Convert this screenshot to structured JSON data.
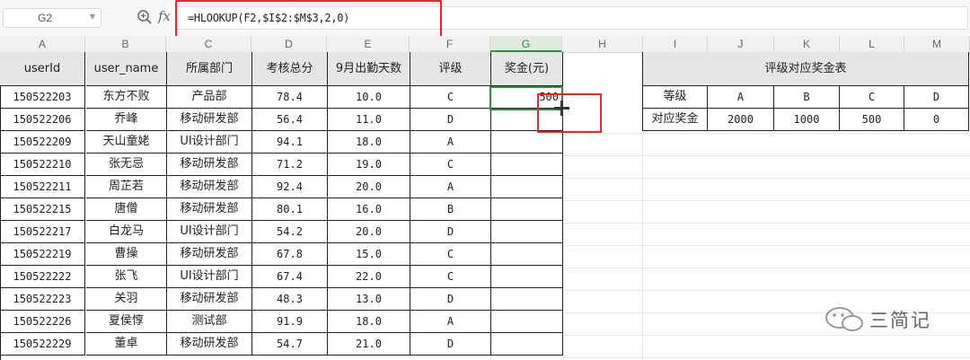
{
  "formula_bar": {
    "name_box": "G2",
    "formula": "=HLOOKUP(F2,$I$2:$M$3,2,0)"
  },
  "columns": [
    "A",
    "B",
    "C",
    "D",
    "E",
    "F",
    "G",
    "H",
    "I",
    "J",
    "K",
    "L",
    "M"
  ],
  "selected_column": "G",
  "main_table": {
    "headers": [
      "userId",
      "user_name",
      "所属部门",
      "考核总分",
      "9月出勤天数",
      "评级",
      "奖金(元)"
    ],
    "rows": [
      [
        "150522203",
        "东方不败",
        "产品部",
        "78.4",
        "10.0",
        "C",
        "500"
      ],
      [
        "150522206",
        "乔峰",
        "移动研发部",
        "56.4",
        "11.0",
        "D",
        ""
      ],
      [
        "150522209",
        "天山童姥",
        "UI设计部门",
        "94.1",
        "18.0",
        "A",
        ""
      ],
      [
        "150522210",
        "张无忌",
        "移动研发部",
        "71.2",
        "19.0",
        "C",
        ""
      ],
      [
        "150522211",
        "周芷若",
        "移动研发部",
        "92.4",
        "20.0",
        "A",
        ""
      ],
      [
        "150522215",
        "唐僧",
        "移动研发部",
        "80.1",
        "16.0",
        "B",
        ""
      ],
      [
        "150522217",
        "白龙马",
        "UI设计部门",
        "54.2",
        "20.0",
        "D",
        ""
      ],
      [
        "150522219",
        "曹操",
        "移动研发部",
        "67.8",
        "15.0",
        "C",
        ""
      ],
      [
        "150522222",
        "张飞",
        "UI设计部门",
        "67.4",
        "22.0",
        "C",
        ""
      ],
      [
        "150522223",
        "关羽",
        "移动研发部",
        "48.3",
        "13.0",
        "D",
        ""
      ],
      [
        "150522226",
        "夏侯惇",
        "测试部",
        "91.9",
        "18.0",
        "A",
        ""
      ],
      [
        "150522229",
        "董卓",
        "移动研发部",
        "54.7",
        "21.0",
        "D",
        ""
      ]
    ]
  },
  "lookup_table": {
    "title": "评级对应奖金表",
    "row1": [
      "等级",
      "A",
      "B",
      "C",
      "D"
    ],
    "row2": [
      "对应奖金",
      "2000",
      "1000",
      "500",
      "0"
    ]
  },
  "watermark": "三简记",
  "colors": {
    "highlight_red": "#e8262b",
    "selection_green": "#3a8b43",
    "header_gray": "#e6e6e6"
  }
}
